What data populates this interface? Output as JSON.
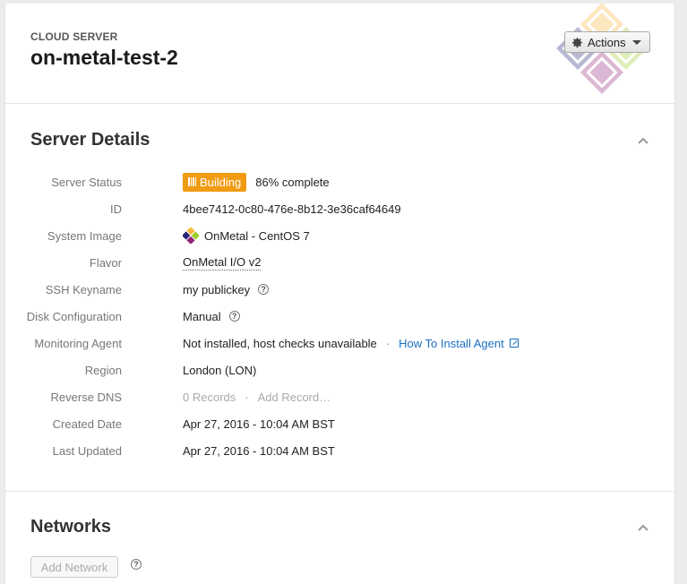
{
  "header": {
    "eyebrow": "CLOUD SERVER",
    "server_name": "on-metal-test-2",
    "actions_label": "Actions"
  },
  "server_details": {
    "title": "Server Details",
    "rows": {
      "status": {
        "label": "Server Status",
        "badge": "Building",
        "progress_text": "86% complete",
        "progress": 0.86
      },
      "id": {
        "label": "ID",
        "value": "4bee7412-0c80-476e-8b12-3e36caf64649"
      },
      "image": {
        "label": "System Image",
        "value": "OnMetal - CentOS 7"
      },
      "flavor": {
        "label": "Flavor",
        "value": "OnMetal I/O v2"
      },
      "ssh": {
        "label": "SSH Keyname",
        "value": "my publickey"
      },
      "disk": {
        "label": "Disk Configuration",
        "value": "Manual"
      },
      "monitoring": {
        "label": "Monitoring Agent",
        "value": "Not installed, host checks unavailable",
        "link": "How To Install Agent"
      },
      "region": {
        "label": "Region",
        "value": "London (LON)"
      },
      "dns": {
        "label": "Reverse DNS",
        "records": "0 Records",
        "add": "Add Record…"
      },
      "created": {
        "label": "Created Date",
        "value": "Apr 27, 2016 - 10:04 AM BST"
      },
      "updated": {
        "label": "Last Updated",
        "value": "Apr 27, 2016 - 10:04 AM BST"
      }
    }
  },
  "networks": {
    "title": "Networks",
    "add_label": "Add Network"
  },
  "help_glyph": "?",
  "separator_glyph": "·",
  "colors": {
    "badge": "#f19b13",
    "link": "#1a6fc2"
  },
  "icons": [
    "gear-icon",
    "chevron-up-icon",
    "help-icon",
    "external-link-icon",
    "centos-logo-icon"
  ]
}
